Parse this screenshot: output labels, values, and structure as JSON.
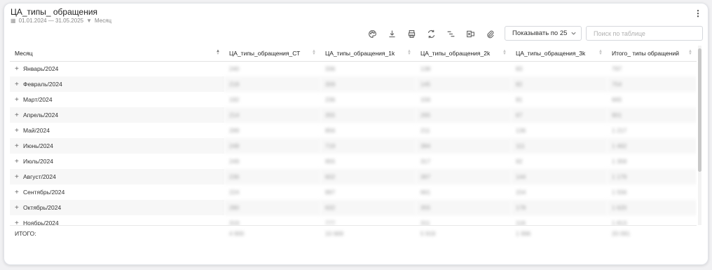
{
  "header": {
    "title": "ЦА_типы_ обращения",
    "date_range": "01.01.2024 — 31.05.2025",
    "filter": "Месяц"
  },
  "toolbar": {
    "icons": [
      "palette-icon",
      "download-icon",
      "print-icon",
      "refresh-icon",
      "hierarchy-icon",
      "excel-icon",
      "attachment-icon"
    ],
    "page_size": "Показывать по 25",
    "search_placeholder": "Поиск по таблице"
  },
  "table": {
    "columns": [
      "Месяц",
      "ЦА_типы_обращения_СТ",
      "ЦА_типы_обращения_1k",
      "ЦА_типы_обращения_2k",
      "ЦА_типы_обращения_3k",
      "Итого_ типы обращений"
    ],
    "rows": [
      {
        "month": "Январь/2024",
        "v": [
          "240",
          "336",
          "138",
          "83",
          "797"
        ]
      },
      {
        "month": "Февраль/2024",
        "v": [
          "218",
          "309",
          "145",
          "82",
          "754"
        ]
      },
      {
        "month": "Март/2024",
        "v": [
          "192",
          "236",
          "156",
          "81",
          "665"
        ]
      },
      {
        "month": "Апрель/2024",
        "v": [
          "214",
          "355",
          "265",
          "67",
          "901"
        ]
      },
      {
        "month": "Май/2024",
        "v": [
          "299",
          "856",
          "211",
          "136",
          "1 217"
        ]
      },
      {
        "month": "Июнь/2024",
        "v": [
          "248",
          "719",
          "384",
          "111",
          "1 462"
        ]
      },
      {
        "month": "Июль/2024",
        "v": [
          "249",
          "955",
          "317",
          "92",
          "1 359"
        ]
      },
      {
        "month": "Август/2024",
        "v": [
          "236",
          "602",
          "397",
          "144",
          "1 179"
        ]
      },
      {
        "month": "Сентябрь/2024",
        "v": [
          "224",
          "897",
          "661",
          "154",
          "1 556"
        ]
      },
      {
        "month": "Октябрь/2024",
        "v": [
          "280",
          "632",
          "355",
          "178",
          "1 620"
        ]
      },
      {
        "month": "Ноябрь/2024",
        "v": [
          "319",
          "777",
          "311",
          "118",
          "1 813"
        ]
      }
    ],
    "total_label": "ИТОГО:",
    "totals": [
      "4 900",
      "10 669",
      "5 919",
      "1 996",
      "20 091"
    ]
  }
}
